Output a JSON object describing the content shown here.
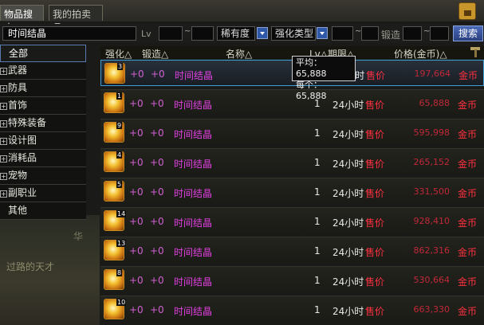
{
  "tabs": {
    "search": "物品搜索",
    "my_auctions": "我的拍卖品"
  },
  "search": {
    "value": "时间结晶",
    "lv_label": "Lv",
    "rarity": "稀有度",
    "enhance_type": "强化类型",
    "forge_label": "锻造",
    "button": "搜索"
  },
  "sidebar": {
    "items": [
      {
        "label": "全部",
        "expandable": false
      },
      {
        "label": "武器",
        "expandable": true
      },
      {
        "label": "防具",
        "expandable": true
      },
      {
        "label": "首饰",
        "expandable": true
      },
      {
        "label": "特殊装备",
        "expandable": true
      },
      {
        "label": "设计图",
        "expandable": true
      },
      {
        "label": "消耗品",
        "expandable": true
      },
      {
        "label": "宠物",
        "expandable": true
      },
      {
        "label": "副职业",
        "expandable": true
      },
      {
        "label": "其他",
        "expandable": false
      }
    ]
  },
  "header": {
    "enhance": "强化△",
    "forge": "锻造△",
    "name": "名称△",
    "lv_time": "Lv△期限△",
    "price": "价格(金币)△"
  },
  "tooltip": {
    "avg": "平均：65,888",
    "each": "每个：65,888"
  },
  "rows": [
    {
      "lvl": "3",
      "enhance": "+0",
      "forge": "+0",
      "name": "时间结晶",
      "qty": "1",
      "time": "24小时",
      "price_label": "售价",
      "price": "197,664",
      "currency": "金币"
    },
    {
      "lvl": "1",
      "enhance": "+0",
      "forge": "+0",
      "name": "时间结晶",
      "qty": "1",
      "time": "24小时",
      "price_label": "售价",
      "price": "65,888",
      "currency": "金币"
    },
    {
      "lvl": "9",
      "enhance": "+0",
      "forge": "+0",
      "name": "时间结晶",
      "qty": "1",
      "time": "24小时",
      "price_label": "售价",
      "price": "595,998",
      "currency": "金币"
    },
    {
      "lvl": "4",
      "enhance": "+0",
      "forge": "+0",
      "name": "时间结晶",
      "qty": "1",
      "time": "24小时",
      "price_label": "售价",
      "price": "265,152",
      "currency": "金币"
    },
    {
      "lvl": "5",
      "enhance": "+0",
      "forge": "+0",
      "name": "时间结晶",
      "qty": "1",
      "time": "24小时",
      "price_label": "售价",
      "price": "331,500",
      "currency": "金币"
    },
    {
      "lvl": "14",
      "enhance": "+0",
      "forge": "+0",
      "name": "时间结晶",
      "qty": "1",
      "time": "24小时",
      "price_label": "售价",
      "price": "928,410",
      "currency": "金币"
    },
    {
      "lvl": "13",
      "enhance": "+0",
      "forge": "+0",
      "name": "时间结晶",
      "qty": "1",
      "time": "24小时",
      "price_label": "售价",
      "price": "862,316",
      "currency": "金币"
    },
    {
      "lvl": "8",
      "enhance": "+0",
      "forge": "+0",
      "name": "时间结晶",
      "qty": "1",
      "time": "24小时",
      "price_label": "售价",
      "price": "530,664",
      "currency": "金币"
    },
    {
      "lvl": "10",
      "enhance": "+0",
      "forge": "+0",
      "name": "时间结晶",
      "qty": "1",
      "time": "24小时",
      "price_label": "售价",
      "price": "663,330",
      "currency": "金币"
    }
  ],
  "background": {
    "text1": "过路的天才",
    "text2": "华"
  }
}
